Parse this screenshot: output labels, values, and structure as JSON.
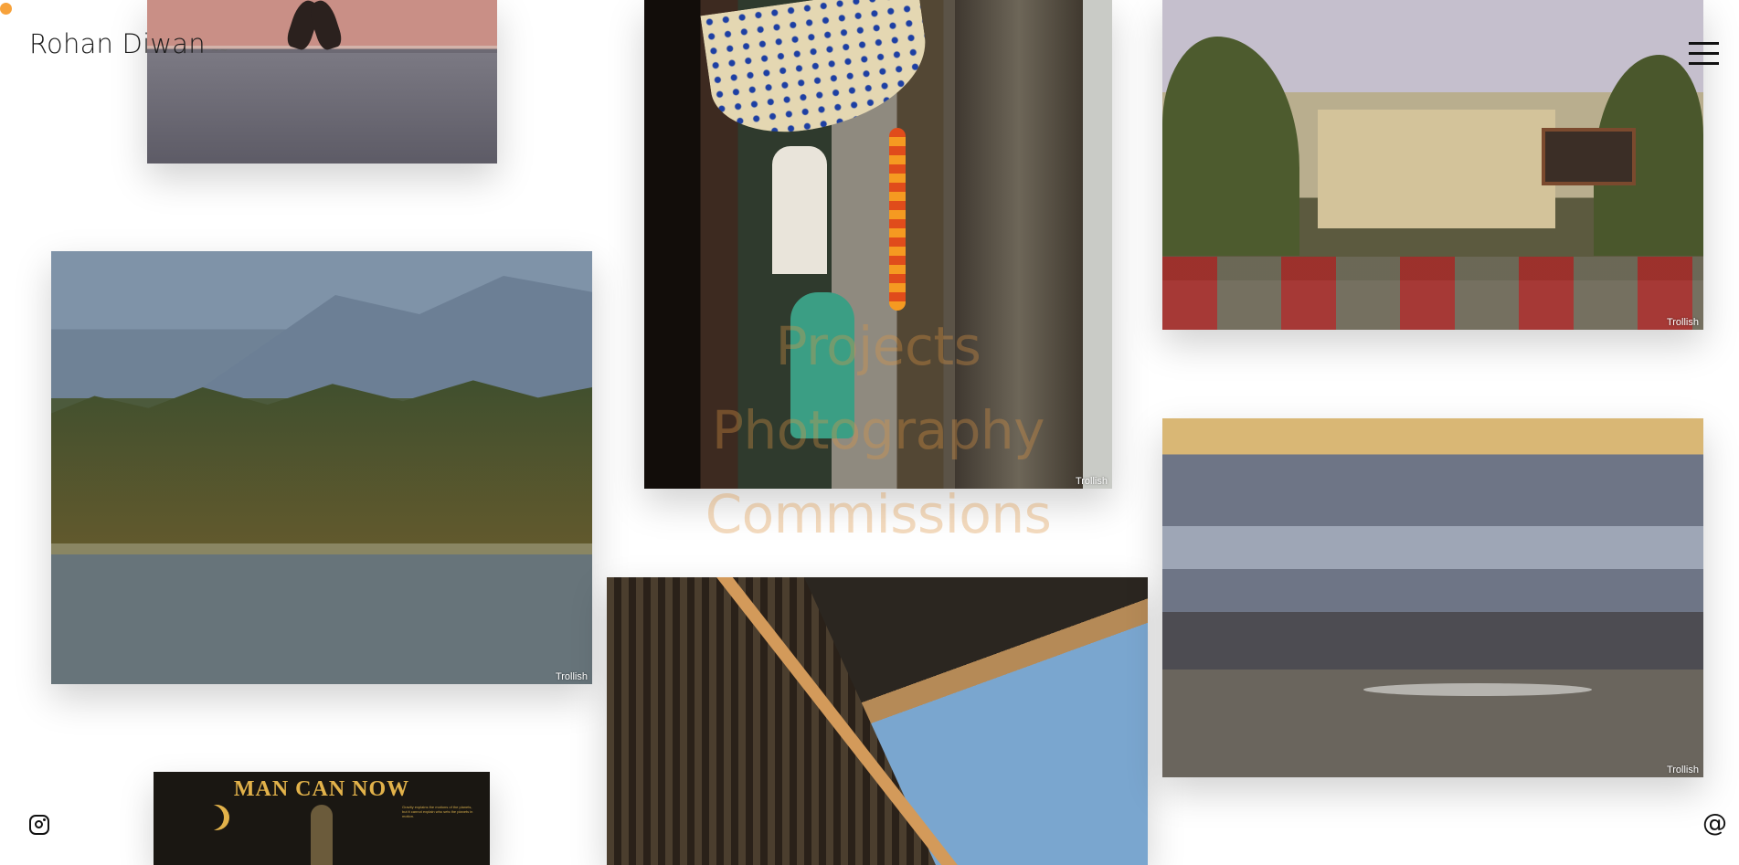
{
  "site": {
    "title": "Rohan Diwan",
    "signature": "~~"
  },
  "nav": {
    "items": [
      {
        "label": "Projects"
      },
      {
        "label": "Photography"
      },
      {
        "label": "Commissions"
      }
    ]
  },
  "gallery": {
    "watermark": "Trollish",
    "poster_title": "MAN CAN NOW",
    "poster_text": "Gravity explains the motions of the planets, but it cannot explain who sets the planets in motion."
  },
  "icons": {
    "menu": "hamburger-icon",
    "instagram": "instagram-icon",
    "email": "at-icon",
    "email_glyph": "@"
  },
  "colors": {
    "accent": "#f7a23b",
    "nav_text": "#de9646"
  }
}
